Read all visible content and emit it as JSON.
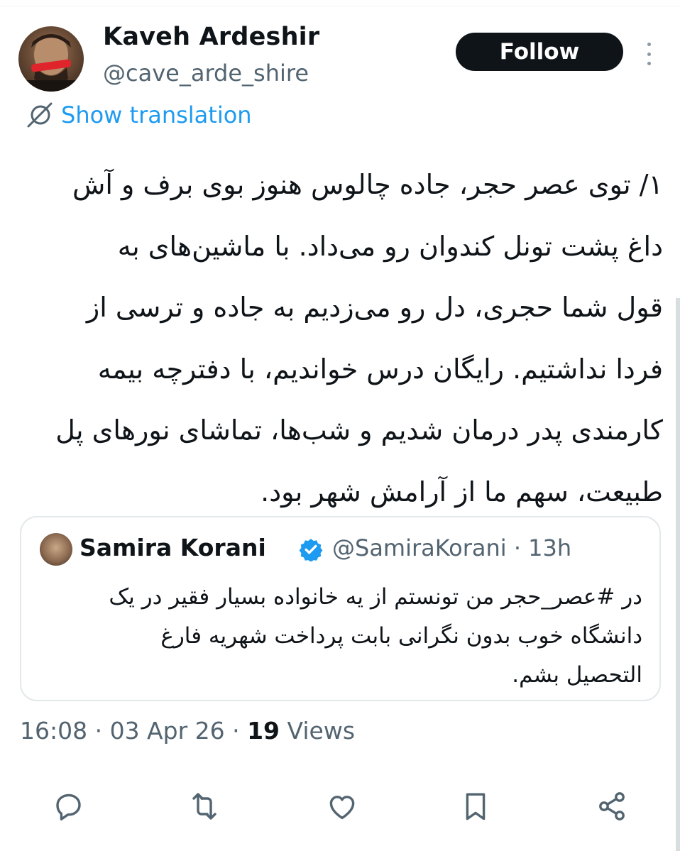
{
  "author": {
    "display_name": "Kaveh Ardeshir",
    "handle": "@cave_arde_shire"
  },
  "follow_label": "Follow",
  "translation_label": "Show translation",
  "tweet_lines": [
    "۱/ توی عصر حجر، جاده چالوس هنوز بوی برف و آش",
    "داغ پشت تونل کندوان رو می‌داد. با ماشین‌های به",
    "قول شما حجری، دل رو می‌زدیم به جاده و ترسی از",
    "فردا نداشتیم. رایگان درس خواندیم، با دفترچه بیمه",
    "کارمندی پدر درمان شدیم و شب‌ها، تماشای نورهای پل",
    "طبیعت، سهم ما از آرامش شهر بود."
  ],
  "quote": {
    "display_name": "Samira Korani",
    "handle_time": "@SamiraKorani · 13h",
    "lines": [
      "در #عصر_حجر من تونستم از یه خانواده بسیار فقیر در یک",
      "دانشگاه خوب بدون نگرانی بابت پرداخت شهریه فارغ",
      "التحصیل بشم."
    ]
  },
  "meta": {
    "timestamp": "16:08 · 03 Apr 26 · ",
    "views_count": "19",
    "views_label": " Views"
  },
  "icons": {
    "reply": "speech-bubble-icon",
    "retweet": "retweet-arrows-icon",
    "like": "heart-icon",
    "bookmark": "bookmark-icon",
    "share": "share-nodes-icon"
  },
  "colors": {
    "link": "#1d9bf0",
    "secondary_text": "#536471",
    "primary_text": "#0f1419",
    "verified": "#1d9bf0"
  }
}
